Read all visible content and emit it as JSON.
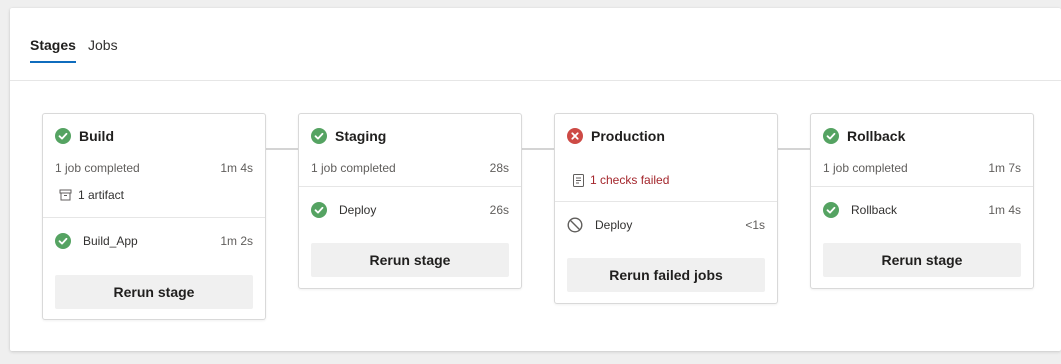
{
  "tabs": [
    {
      "label": "Stages",
      "active": true
    },
    {
      "label": "Jobs",
      "active": false
    }
  ],
  "colors": {
    "success": "#55a362",
    "failure": "#cd4a45",
    "accent": "#0f6cbd",
    "failed_text": "#a4262c"
  },
  "stages": [
    {
      "title": "Build",
      "status": "success",
      "status_icon": "check-circle-icon",
      "summary": "1 job completed",
      "duration": "1m 4s",
      "artifact": "1 artifact",
      "jobs": [
        {
          "name": "Build_App",
          "duration": "1m 2s",
          "status": "success"
        }
      ],
      "button": "Rerun stage"
    },
    {
      "title": "Staging",
      "status": "success",
      "status_icon": "check-circle-icon",
      "summary": "1 job completed",
      "duration": "28s",
      "jobs": [
        {
          "name": "Deploy",
          "duration": "26s",
          "status": "success"
        }
      ],
      "button": "Rerun stage"
    },
    {
      "title": "Production",
      "status": "failed",
      "status_icon": "error-circle-icon",
      "checks": "1 checks failed",
      "jobs": [
        {
          "name": "Deploy",
          "duration": "<1s",
          "status": "skipped"
        }
      ],
      "button": "Rerun failed jobs"
    },
    {
      "title": "Rollback",
      "status": "success",
      "status_icon": "check-circle-icon",
      "summary": "1 job completed",
      "duration": "1m 7s",
      "jobs": [
        {
          "name": "Rollback",
          "duration": "1m 4s",
          "status": "success"
        }
      ],
      "button": "Rerun stage"
    }
  ]
}
